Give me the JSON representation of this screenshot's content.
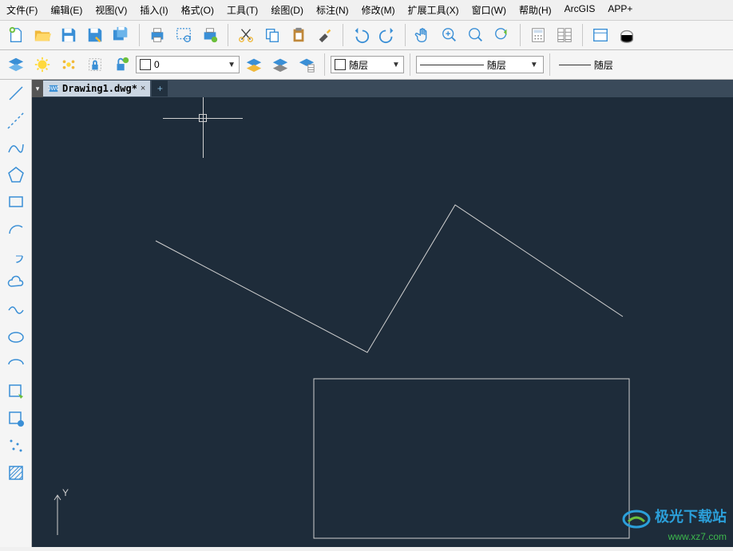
{
  "menu": {
    "file": "文件(F)",
    "edit": "编辑(E)",
    "view": "视图(V)",
    "insert": "插入(I)",
    "format": "格式(O)",
    "tools": "工具(T)",
    "draw": "绘图(D)",
    "annotate": "标注(N)",
    "modify": "修改(M)",
    "extend": "扩展工具(X)",
    "window": "窗口(W)",
    "help": "帮助(H)",
    "arcgis": "ArcGIS",
    "app": "APP+"
  },
  "layer": {
    "current": "0"
  },
  "props": {
    "by_layer1": "随层",
    "by_layer2": "随层",
    "by_layer3": "随层"
  },
  "tab": {
    "name": "Drawing1.dwg*",
    "close": "×",
    "new": "+"
  },
  "ucs": {
    "y": "Y"
  },
  "watermark": {
    "title": "极光下载站",
    "url": "www.xz7.com"
  }
}
